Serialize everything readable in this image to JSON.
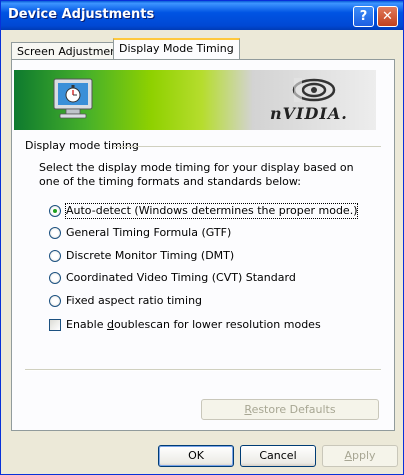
{
  "window": {
    "title": "Device Adjustments",
    "help_glyph": "?",
    "close_glyph": "✕"
  },
  "tabs": [
    {
      "label": "Screen Adjustment",
      "active": false
    },
    {
      "label": "Display Mode Timing",
      "active": true
    }
  ],
  "banner": {
    "brand_text": "nVIDIA.",
    "monitor_icon": "monitor-stopwatch-icon",
    "logo_icon": "nvidia-eye-logo"
  },
  "group": {
    "label": "Display mode timing",
    "description": "Select the display mode timing for your display based on one of the timing formats and standards below:"
  },
  "options": [
    {
      "label": "Auto-detect (Windows determines the proper mode.)",
      "selected": true
    },
    {
      "label": "General Timing Formula (GTF)",
      "selected": false
    },
    {
      "label": "Discrete Monitor Timing (DMT)",
      "selected": false
    },
    {
      "label": "Coordinated Video Timing (CVT) Standard",
      "selected": false
    },
    {
      "label": "Fixed aspect ratio timing",
      "selected": false
    }
  ],
  "checkbox": {
    "label_prefix": "Enable ",
    "label_accel": "d",
    "label_rest": "oublescan for lower resolution modes",
    "checked": false
  },
  "buttons": {
    "restore_accel": "R",
    "restore_rest": "estore Defaults",
    "ok": "OK",
    "cancel": "Cancel",
    "apply_accel": "A",
    "apply_rest": "pply"
  },
  "colors": {
    "titlebar": "#0054e3",
    "radio_dot": "#21a121",
    "tab_highlight": "#ffc83c"
  }
}
